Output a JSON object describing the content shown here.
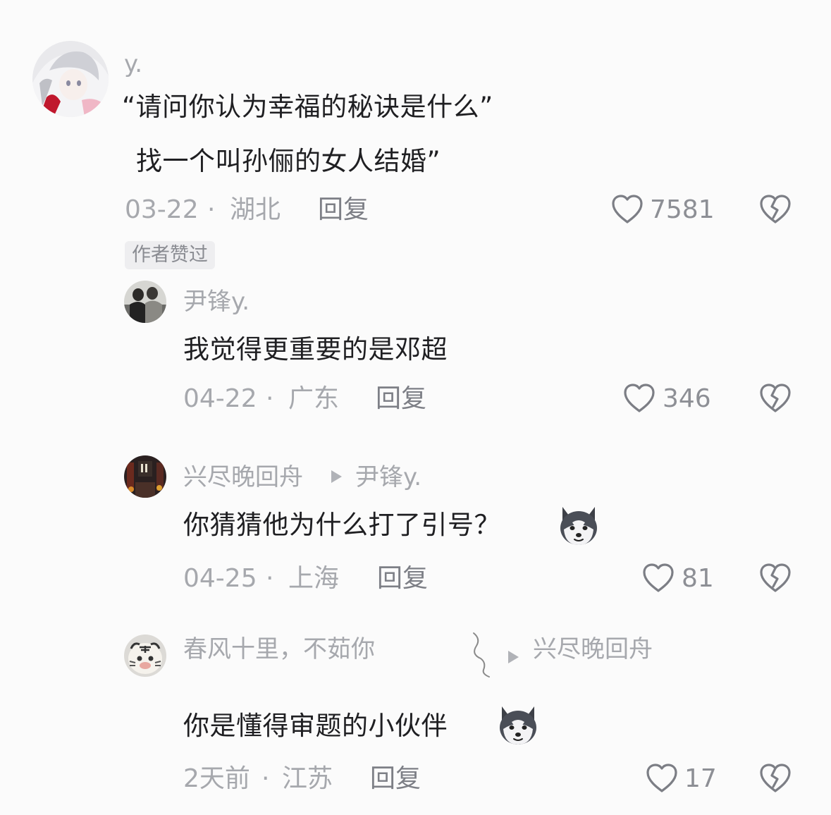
{
  "comments": [
    {
      "username": "y.",
      "lines": [
        "“请问你认为幸福的秘诀是什么”",
        "找一个叫孙俪的女人结婚”"
      ],
      "date": "03-22",
      "location": "湖北",
      "reply_label": "回复",
      "likes": "7581",
      "badge": "作者赞过"
    },
    {
      "username": "尹锋y.",
      "text": "我觉得更重要的是邓超",
      "date": "04-22",
      "location": "广东",
      "reply_label": "回复",
      "likes": "346"
    },
    {
      "username": "兴尽晚回舟",
      "reply_to": "尹锋y.",
      "text": "你猜猜他为什么打了引号？",
      "date": "04-25",
      "location": "上海",
      "reply_label": "回复",
      "likes": "81"
    },
    {
      "username": "春风十里，不茹你",
      "reply_to": "兴尽晚回舟",
      "text": "你是懂得审题的小伙伴",
      "date": "2天前",
      "location": "江苏",
      "reply_label": "回复",
      "likes": "17"
    }
  ],
  "separator": "·",
  "icons": {
    "like": "heart-outline-icon",
    "dislike": "broken-heart-icon",
    "reply_to": "play-triangle-icon",
    "emoji": "husky-dog-emoji"
  },
  "colors": {
    "background": "#fbfbfb",
    "text_primary": "#1f1f22",
    "text_secondary": "#a6a8ad",
    "badge_bg": "#eeeef0"
  }
}
